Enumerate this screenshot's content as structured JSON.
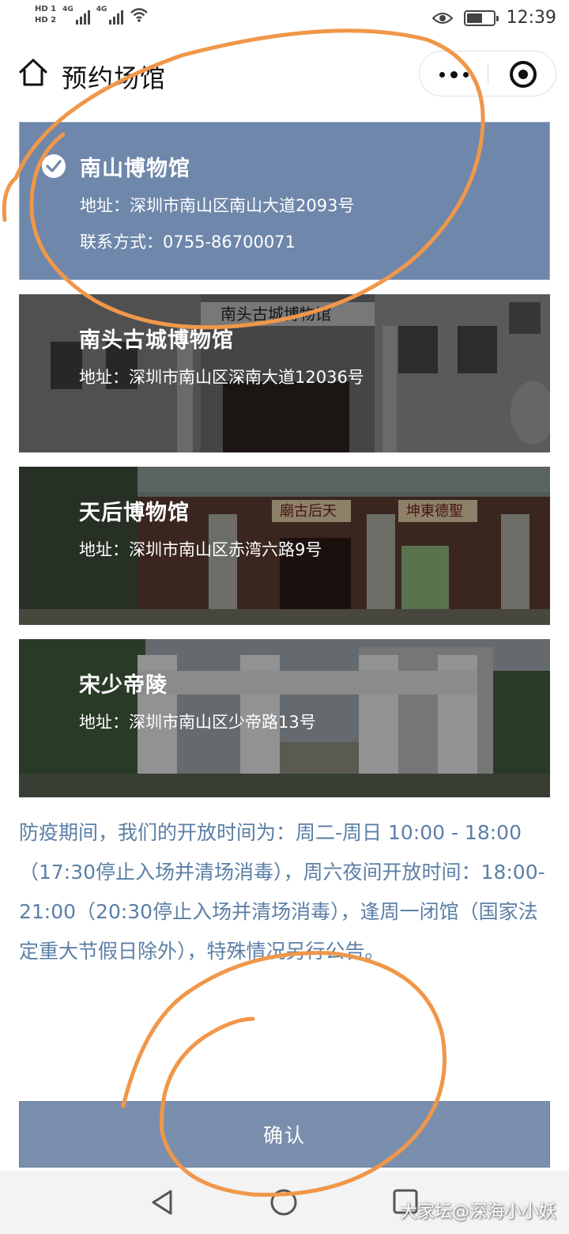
{
  "status_bar": {
    "sim1": "HD 1",
    "sim2": "HD 2",
    "net1": "4G",
    "net2": "4G",
    "time": "12:39",
    "battery_level": 0.6
  },
  "nav": {
    "title": "预约场馆"
  },
  "venues": [
    {
      "name": "南山博物馆",
      "address": "地址：深圳市南山区南山大道2093号",
      "contact": "联系方式：0755-86700071",
      "selected": true
    },
    {
      "name": "南头古城博物馆",
      "address": "地址：深圳市南山区深南大道12036号",
      "sign": "南头古城博物馆"
    },
    {
      "name": "天后博物馆",
      "address": "地址：深圳市南山区赤湾六路9号",
      "sign_left": "廟古后天",
      "sign_right": "坤東德聖"
    },
    {
      "name": "宋少帝陵",
      "address": "地址：深圳市南山区少帝路13号"
    }
  ],
  "notice": "防疫期间，我们的开放时间为：周二-周日 10:00 - 18:00（17:30停止入场并清场消毒），周六夜间开放时间：18:00-21:00（20:30停止入场并清场消毒），逢周一闭馆（国家法定重大节假日除外），特殊情况另行公告。",
  "confirm_label": "确认",
  "watermark": "大家坛@深海小小妖",
  "colors": {
    "selected_card": "#6e87aa",
    "notice_text": "#5b7fa6",
    "confirm_button": "#7a8fae",
    "annotation": "#f0974a"
  }
}
